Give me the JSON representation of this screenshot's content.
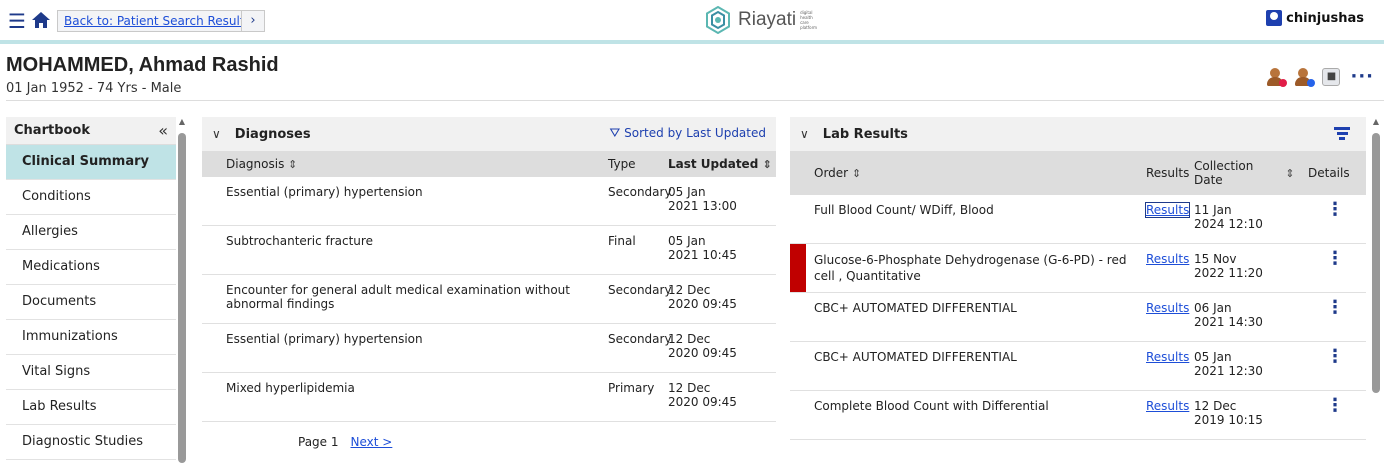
{
  "topbar": {
    "back_label": "Back to: Patient Search Results",
    "forward_label": "›",
    "brand_name": "Riayati",
    "brand_tagline": "digital health care platform",
    "username": "chinjushas"
  },
  "patient": {
    "name": "MOHAMMED, Ahmad Rashid",
    "info": "01 Jan 1952 - 74 Yrs - Male"
  },
  "sidebar": {
    "title": "Chartbook",
    "collapse_glyph": "«",
    "items": [
      {
        "label": "Clinical Summary"
      },
      {
        "label": "Conditions"
      },
      {
        "label": "Allergies"
      },
      {
        "label": "Medications"
      },
      {
        "label": "Documents"
      },
      {
        "label": "Immunizations"
      },
      {
        "label": "Vital Signs"
      },
      {
        "label": "Lab Results"
      },
      {
        "label": "Diagnostic Studies"
      }
    ]
  },
  "diagnoses": {
    "title": "Diagnoses",
    "sort_note": "Sorted by Last Updated",
    "columns": [
      "Diagnosis",
      "Type",
      "Last Updated"
    ],
    "rows": [
      {
        "diagnosis": "Essential (primary) hypertension",
        "type": "Secondary",
        "date": "05 Jan",
        "time": "2021 13:00"
      },
      {
        "diagnosis": "Subtrochanteric fracture",
        "type": "Final",
        "date": "05 Jan",
        "time": "2021 10:45"
      },
      {
        "diagnosis": "Encounter for general adult medical examination without abnormal findings",
        "type": "Secondary",
        "date": "12 Dec",
        "time": "2020 09:45"
      },
      {
        "diagnosis": "Essential (primary) hypertension",
        "type": "Secondary",
        "date": "12 Dec",
        "time": "2020 09:45"
      },
      {
        "diagnosis": "Mixed hyperlipidemia",
        "type": "Primary",
        "date": "12 Dec",
        "time": "2020 09:45"
      }
    ],
    "pager": {
      "page_label": "Page 1",
      "next_label": "Next >"
    }
  },
  "lab_results": {
    "title": "Lab Results",
    "columns": [
      "Order",
      "Results",
      "Collection Date",
      "Details"
    ],
    "rows": [
      {
        "order": "Full Blood Count/ WDiff, Blood",
        "results": "Results",
        "date": "11 Jan",
        "time": "2024 12:10",
        "flag_color": ""
      },
      {
        "order": "Glucose-6-Phosphate Dehydrogenase (G-6-PD) - red cell , Quantitative",
        "results": "Results",
        "date": "15 Nov",
        "time": "2022 11:20",
        "flag_color": "#c00000"
      },
      {
        "order": "CBC+ AUTOMATED DIFFERENTIAL",
        "results": "Results",
        "date": "06 Jan",
        "time": "2021 14:30",
        "flag_color": ""
      },
      {
        "order": "CBC+ AUTOMATED DIFFERENTIAL",
        "results": "Results",
        "date": "05 Jan",
        "time": "2021 12:30",
        "flag_color": ""
      },
      {
        "order": "Complete Blood Count with Differential",
        "results": "Results",
        "date": "12 Dec",
        "time": "2019 10:15",
        "flag_color": ""
      }
    ]
  },
  "colors": {
    "accent": "#bfe3e6",
    "link": "#1d4ed8",
    "flag": "#c00000"
  }
}
